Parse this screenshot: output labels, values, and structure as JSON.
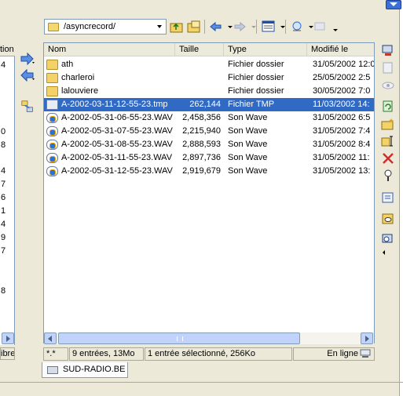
{
  "path": {
    "value": "/asyncrecord/"
  },
  "left_panel": {
    "header_fragment": "tion",
    "numbers": [
      "4",
      "0",
      "8",
      "4",
      "7",
      "6",
      "1",
      "4",
      "9",
      "7",
      "8"
    ],
    "status_fragment": "ibre"
  },
  "columns": [
    "Nom",
    "Taille",
    "Type",
    "Modifié le"
  ],
  "files": [
    {
      "name": "ath",
      "size": "",
      "type": "Fichier dossier",
      "modified": "31/05/2002 12:0",
      "icon": "folder-icon"
    },
    {
      "name": "charleroi",
      "size": "",
      "type": "Fichier dossier",
      "modified": "25/05/2002 2:5",
      "icon": "folder-icon"
    },
    {
      "name": "lalouviere",
      "size": "",
      "type": "Fichier dossier",
      "modified": "30/05/2002 7:0",
      "icon": "folder-icon"
    },
    {
      "name": "A-2002-03-11-12-55-23.tmp",
      "size": "262,144",
      "type": "Fichier TMP",
      "modified": "11/03/2002 14:",
      "icon": "tmp-file-icon",
      "selected": true
    },
    {
      "name": "A-2002-05-31-06-55-23.WAV",
      "size": "2,458,356",
      "type": "Son Wave",
      "modified": "31/05/2002 6:5",
      "icon": "wav-file-icon"
    },
    {
      "name": "A-2002-05-31-07-55-23.WAV",
      "size": "2,215,940",
      "type": "Son Wave",
      "modified": "31/05/2002 7:4",
      "icon": "wav-file-icon"
    },
    {
      "name": "A-2002-05-31-08-55-23.WAV",
      "size": "2,888,593",
      "type": "Son Wave",
      "modified": "31/05/2002 8:4",
      "icon": "wav-file-icon"
    },
    {
      "name": "A-2002-05-31-11-55-23.WAV",
      "size": "2,897,736",
      "type": "Son Wave",
      "modified": "31/05/2002 11:",
      "icon": "wav-file-icon"
    },
    {
      "name": "A-2002-05-31-12-55-23.WAV",
      "size": "2,919,679",
      "type": "Son Wave",
      "modified": "31/05/2002 13:"
    }
  ],
  "status": {
    "filter": "*.*",
    "count": "9 entrées, 13Mo",
    "selection": "1 entrée sélectionné, 256Ko",
    "online": "En ligne"
  },
  "tab": {
    "label": "SUD-RADIO.BE"
  },
  "colors": {
    "selection": "#316ac5",
    "border": "#7f9db9",
    "background": "#ece9d8"
  }
}
